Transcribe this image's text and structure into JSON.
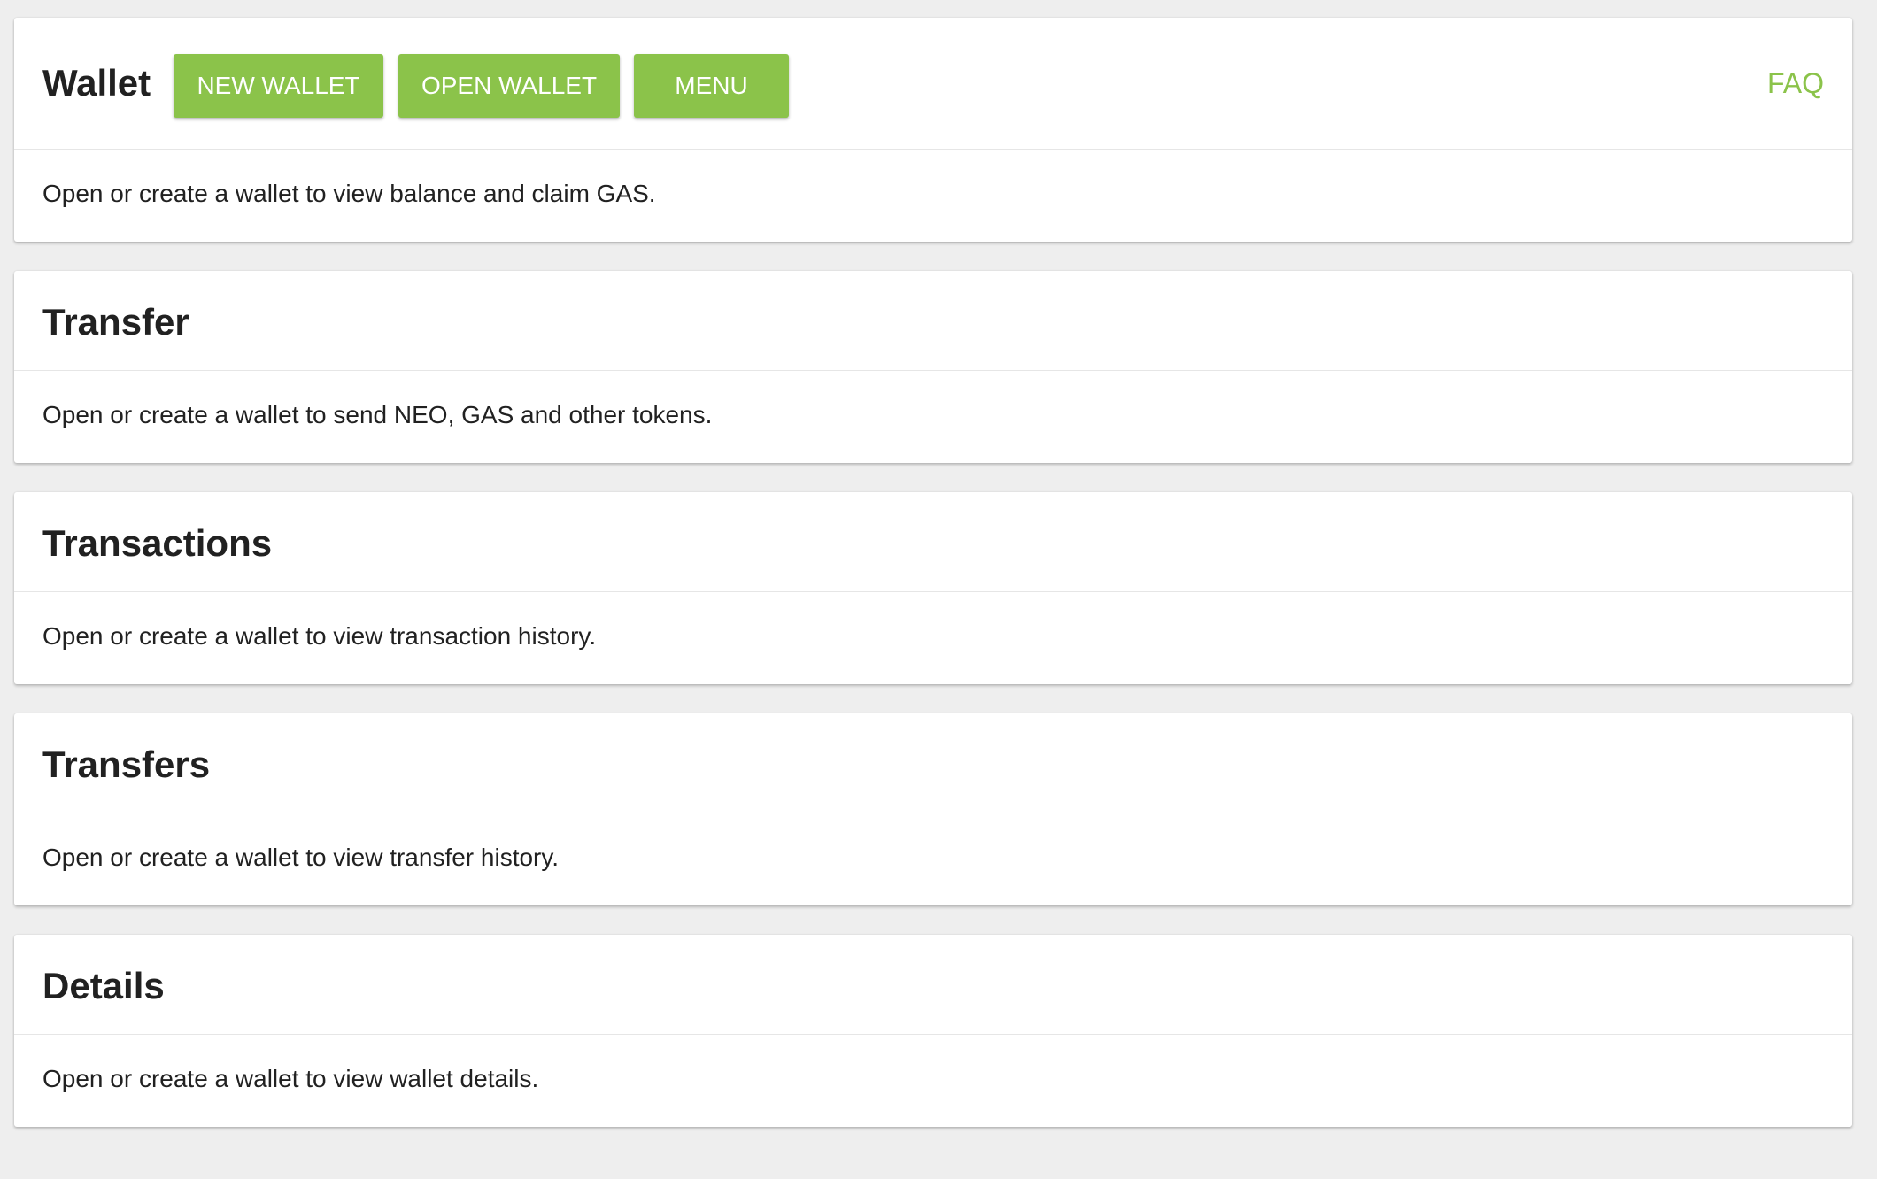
{
  "wallet": {
    "title": "Wallet",
    "buttons": {
      "new_wallet": "NEW WALLET",
      "open_wallet": "OPEN WALLET",
      "menu": "MENU"
    },
    "faq": "FAQ",
    "message": "Open or create a wallet to view balance and claim GAS."
  },
  "transfer": {
    "title": "Transfer",
    "message": "Open or create a wallet to send NEO, GAS and other tokens."
  },
  "transactions": {
    "title": "Transactions",
    "message": "Open or create a wallet to view transaction history."
  },
  "transfers": {
    "title": "Transfers",
    "message": "Open or create a wallet to view transfer history."
  },
  "details": {
    "title": "Details",
    "message": "Open or create a wallet to view wallet details."
  },
  "colors": {
    "accent": "#8bc34a",
    "background": "#eeeeee",
    "card": "#ffffff",
    "text": "#212121"
  }
}
